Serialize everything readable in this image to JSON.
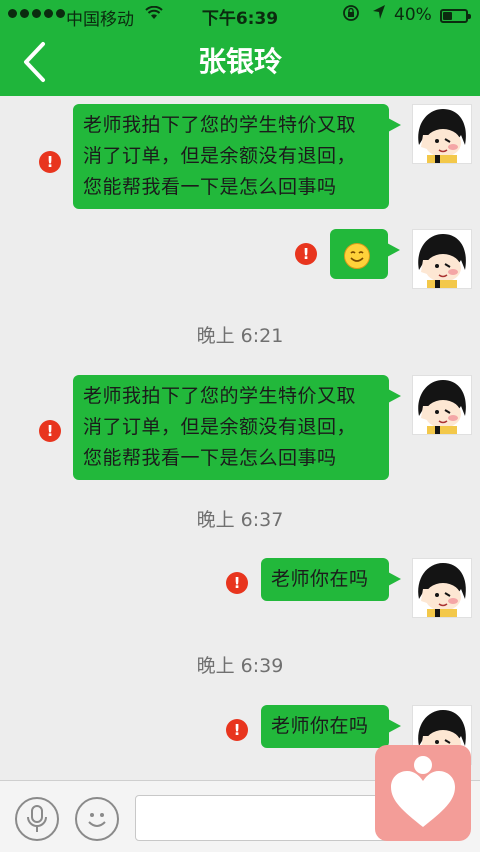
{
  "status_bar": {
    "carrier": "中国移动",
    "time": "下午6:39",
    "battery_percent_text": "40%",
    "battery_level": 0.4
  },
  "header": {
    "title": "张银玲",
    "back_icon": "chevron-left-icon"
  },
  "messages": [
    {
      "type": "text",
      "text_lines": [
        "老师我拍下了您的学生特价又取",
        "消了订单，但是余额没有退回，",
        "您能帮我看一下是怎么回事吗"
      ],
      "failed": true
    },
    {
      "type": "emoji",
      "emoji": "smile-emoji",
      "failed": true
    },
    {
      "type": "timestamp",
      "text": "晚上 6:21"
    },
    {
      "type": "text",
      "text_lines": [
        "老师我拍下了您的学生特价又取",
        "消了订单，但是余额没有退回，",
        "您能帮我看一下是怎么回事吗"
      ],
      "failed": true
    },
    {
      "type": "timestamp",
      "text": "晚上 6:37"
    },
    {
      "type": "text",
      "text_lines": [
        "老师你在吗"
      ],
      "failed": true
    },
    {
      "type": "timestamp",
      "text": "晚上 6:39"
    },
    {
      "type": "text",
      "text_lines": [
        "老师你在吗"
      ],
      "failed": true
    }
  ],
  "failed_marker": "!",
  "input_bar": {
    "voice_icon": "microphone-icon",
    "emoji_icon": "smiley-icon",
    "text_value": ""
  },
  "floating_button": {
    "icon": "heart-icon",
    "color": "#f39d98"
  },
  "colors": {
    "header": "#1fb53b",
    "bubble": "#22b83b",
    "error": "#e8351e"
  }
}
